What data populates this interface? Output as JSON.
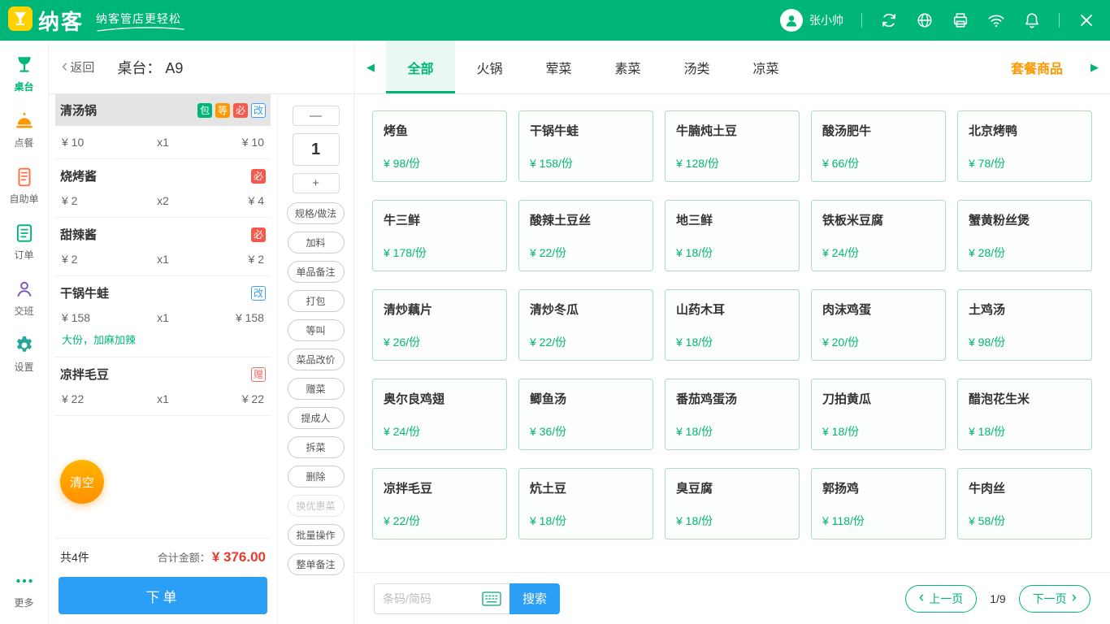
{
  "topbar": {
    "logo_text": "纳客",
    "slogan": "纳客管店更轻松",
    "user_name": "张小帅"
  },
  "sidebar": {
    "items": [
      {
        "label": "桌台",
        "active": true
      },
      {
        "label": "点餐"
      },
      {
        "label": "自助单"
      },
      {
        "label": "订单"
      },
      {
        "label": "交班"
      },
      {
        "label": "设置"
      },
      {
        "label": "更多"
      }
    ]
  },
  "header": {
    "back_label": "返回",
    "table_label": "桌台：",
    "table_number": "A9",
    "combo_label": "套餐商品",
    "tabs": [
      {
        "label": "全部",
        "active": true
      },
      {
        "label": "火锅"
      },
      {
        "label": "荤菜"
      },
      {
        "label": "素菜"
      },
      {
        "label": "汤类"
      },
      {
        "label": "凉菜"
      }
    ]
  },
  "order": {
    "items": [
      {
        "name": "清汤锅",
        "selected": true,
        "badges": [
          {
            "text": "包",
            "type": "b-green"
          },
          {
            "text": "等",
            "type": "b-orange"
          },
          {
            "text": "必",
            "type": "b-red"
          },
          {
            "text": "改",
            "type": "b-blue-o"
          }
        ],
        "price": "¥ 10",
        "qty": "x1",
        "total": "¥ 10"
      },
      {
        "name": "烧烤酱",
        "badges": [
          {
            "text": "必",
            "type": "b-red"
          }
        ],
        "price": "¥ 2",
        "qty": "x2",
        "total": "¥ 4"
      },
      {
        "name": "甜辣酱",
        "badges": [
          {
            "text": "必",
            "type": "b-red"
          }
        ],
        "price": "¥ 2",
        "qty": "x1",
        "total": "¥ 2"
      },
      {
        "name": "干锅牛蛙",
        "badges": [
          {
            "text": "改",
            "type": "b-blue-o"
          }
        ],
        "price": "¥ 158",
        "qty": "x1",
        "total": "¥ 158",
        "note": "大份，加麻加辣"
      },
      {
        "name": "凉拌毛豆",
        "badges": [
          {
            "text": "赠",
            "type": "b-red-o"
          }
        ],
        "price": "¥ 22",
        "qty": "x1",
        "total": "¥ 22"
      }
    ],
    "clear_label": "清空",
    "count_label": "共4件",
    "total_label": "合计金额：",
    "total_amount": "¥ 376.00",
    "submit_label": "下单"
  },
  "tools": {
    "minus_label": "—",
    "quantity": "1",
    "plus_label": "+",
    "buttons": [
      {
        "label": "规格/做法"
      },
      {
        "label": "加料"
      },
      {
        "label": "单品备注"
      },
      {
        "label": "打包"
      },
      {
        "label": "等叫"
      },
      {
        "label": "菜品改价"
      },
      {
        "label": "赠菜"
      },
      {
        "label": "提成人"
      },
      {
        "label": "拆菜"
      },
      {
        "label": "删除"
      },
      {
        "label": "换优惠菜",
        "disabled": true
      },
      {
        "label": "批量操作"
      },
      {
        "label": "整单备注"
      }
    ]
  },
  "menu": {
    "items": [
      {
        "name": "烤鱼",
        "price": "¥ 98/份"
      },
      {
        "name": "干锅牛蛙",
        "price": "¥ 158/份"
      },
      {
        "name": "牛腩炖土豆",
        "price": "¥ 128/份"
      },
      {
        "name": "酸汤肥牛",
        "price": "¥ 66/份"
      },
      {
        "name": "北京烤鸭",
        "price": "¥ 78/份"
      },
      {
        "name": "牛三鲜",
        "price": "¥ 178/份"
      },
      {
        "name": "酸辣土豆丝",
        "price": "¥ 22/份"
      },
      {
        "name": "地三鲜",
        "price": "¥ 18/份"
      },
      {
        "name": "铁板米豆腐",
        "price": "¥ 24/份"
      },
      {
        "name": "蟹黄粉丝煲",
        "price": "¥ 28/份"
      },
      {
        "name": "清炒藕片",
        "price": "¥ 26/份"
      },
      {
        "name": "清炒冬瓜",
        "price": "¥ 22/份"
      },
      {
        "name": "山药木耳",
        "price": "¥ 18/份"
      },
      {
        "name": "肉沫鸡蛋",
        "price": "¥ 20/份"
      },
      {
        "name": "土鸡汤",
        "price": "¥ 98/份"
      },
      {
        "name": "奥尔良鸡翅",
        "price": "¥ 24/份"
      },
      {
        "name": "鲫鱼汤",
        "price": "¥ 36/份"
      },
      {
        "name": "番茄鸡蛋汤",
        "price": "¥ 18/份"
      },
      {
        "name": "刀拍黄瓜",
        "price": "¥ 18/份"
      },
      {
        "name": "醋泡花生米",
        "price": "¥ 18/份"
      },
      {
        "name": "凉拌毛豆",
        "price": "¥ 22/份"
      },
      {
        "name": "炕土豆",
        "price": "¥ 18/份"
      },
      {
        "name": "臭豆腐",
        "price": "¥ 18/份"
      },
      {
        "name": "郭扬鸡",
        "price": "¥ 118/份"
      },
      {
        "name": "牛肉丝",
        "price": "¥ 58/份"
      }
    ]
  },
  "footer": {
    "search_placeholder": "条码/简码",
    "search_label": "搜索",
    "prev_label": "上一页",
    "page_indicator": "1/9",
    "next_label": "下一页"
  }
}
